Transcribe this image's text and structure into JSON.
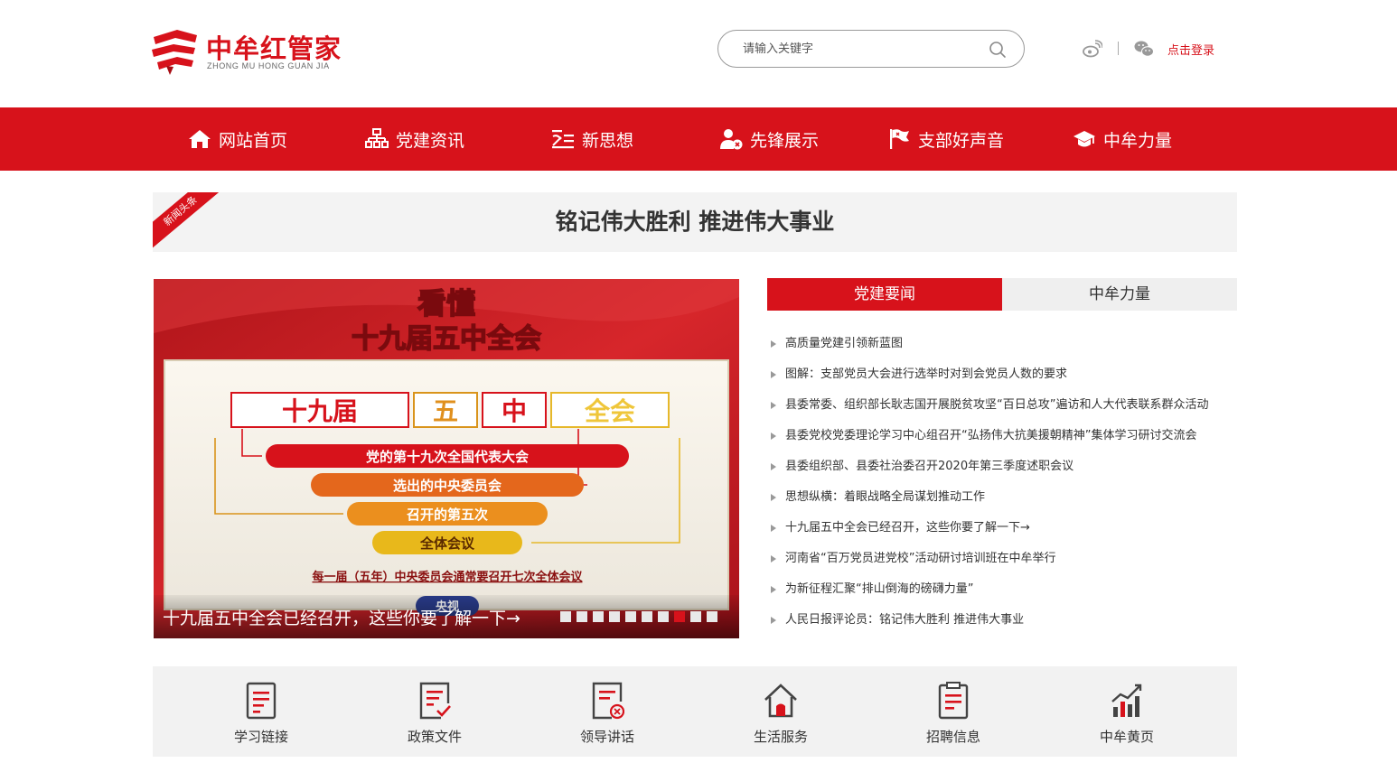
{
  "header": {
    "logo_title": "中牟红管家",
    "logo_subtitle": "ZHONG MU HONG GUAN JIA",
    "search_placeholder": "请输入关键字",
    "login_label": "点击登录"
  },
  "nav": {
    "items": [
      {
        "label": "网站首页",
        "icon": "home-icon"
      },
      {
        "label": "党建资讯",
        "icon": "sitemap-icon"
      },
      {
        "label": "新思想",
        "icon": "party-list-icon"
      },
      {
        "label": "先锋展示",
        "icon": "user-party-icon"
      },
      {
        "label": "支部好声音",
        "icon": "flag-icon"
      },
      {
        "label": "中牟力量",
        "icon": "graduation-cap-icon"
      }
    ]
  },
  "headline": {
    "ribbon": "新闻头条",
    "title": "铭记伟大胜利 推进伟大事业"
  },
  "slider": {
    "caption": "十九届五中全会已经召开，这些你要了解一下→",
    "image_text": {
      "top1": "看懂",
      "top2": "十九届五中全会",
      "box1": "十九届",
      "box2": "五",
      "box3": "中",
      "box4": "全会",
      "pill1": "党的第十九次全国代表大会",
      "pill2": "选出的中央委员会",
      "pill3": "召开的第五次",
      "pill4": "全体会议",
      "footnote": "每一届（五年）中央委员会通常要召开七次全体会议",
      "badge": "央视"
    },
    "dot_count": 10,
    "active_dot": 7
  },
  "news": {
    "tabs": [
      {
        "label": "党建要闻",
        "active": true
      },
      {
        "label": "中牟力量",
        "active": false
      }
    ],
    "items": [
      "高质量党建引领新蓝图",
      "图解：支部党员大会进行选举时对到会党员人数的要求",
      "县委常委、组织部长耿志国开展脱贫攻坚“百日总攻”遍访和人大代表联系群众活动",
      "县委党校党委理论学习中心组召开“弘扬伟大抗美援朝精神”集体学习研讨交流会",
      "县委组织部、县委社治委召开2020年第三季度述职会议",
      "思想纵横：着眼战略全局谋划推动工作",
      "十九届五中全会已经召开，这些你要了解一下→",
      "河南省“百万党员进党校”活动研讨培训班在中牟举行",
      "为新征程汇聚“排山倒海的磅礴力量”",
      "人民日报评论员：铭记伟大胜利 推进伟大事业"
    ]
  },
  "quick_links": [
    {
      "label": "学习链接",
      "icon": "document-lines-icon"
    },
    {
      "label": "政策文件",
      "icon": "document-check-icon"
    },
    {
      "label": "领导讲话",
      "icon": "document-party-icon"
    },
    {
      "label": "生活服务",
      "icon": "house-icon"
    },
    {
      "label": "招聘信息",
      "icon": "clipboard-icon"
    },
    {
      "label": "中牟黄页",
      "icon": "bar-chart-icon"
    }
  ],
  "colors": {
    "brand_red": "#d7121b",
    "panel_gray": "#f2f2f2"
  }
}
